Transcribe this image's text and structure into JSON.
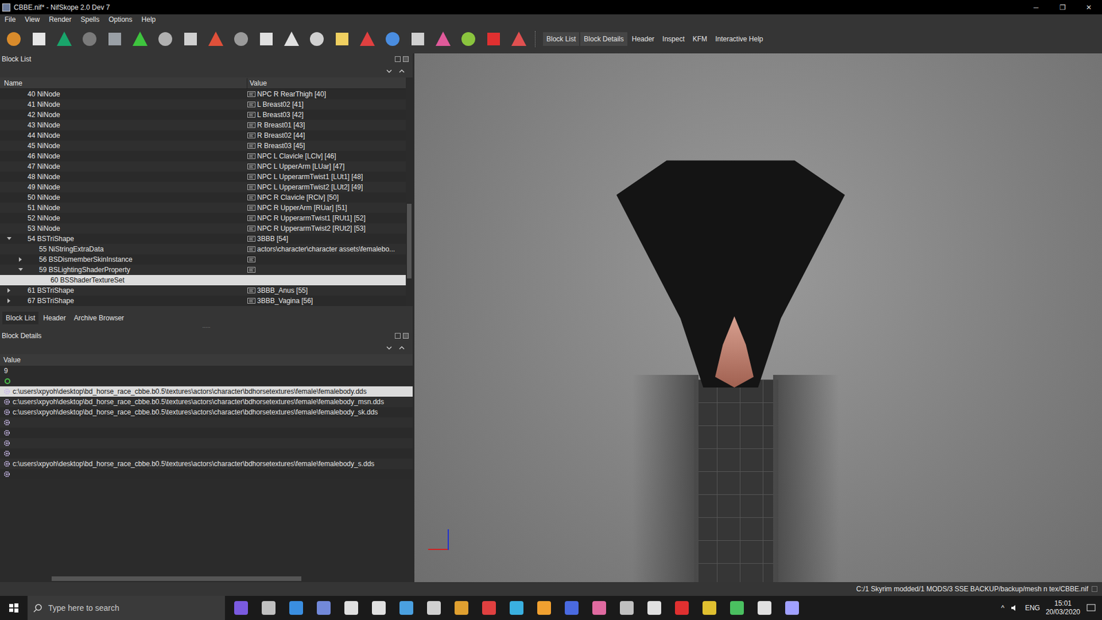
{
  "window": {
    "title": "CBBE.nif* - NifSkope 2.0 Dev 7",
    "controls": [
      "─",
      "❐",
      "✕"
    ]
  },
  "menu": [
    "File",
    "View",
    "Render",
    "Spells",
    "Options",
    "Help"
  ],
  "toolbar_toggles": [
    {
      "label": "Block List",
      "checked": true
    },
    {
      "label": "Block Details",
      "checked": true
    },
    {
      "label": "Header",
      "checked": false
    },
    {
      "label": "Inspect",
      "checked": false
    },
    {
      "label": "KFM",
      "checked": false
    },
    {
      "label": "Interactive Help",
      "checked": false
    }
  ],
  "block_list": {
    "title": "Block List",
    "columns": [
      "Name",
      "Value"
    ],
    "rows": [
      {
        "name": "40 NiNode",
        "value": "NPC R RearThigh [40]",
        "depth": 0,
        "expandable": false,
        "expanded": false,
        "selected": false
      },
      {
        "name": "41 NiNode",
        "value": "L Breast02 [41]",
        "depth": 0,
        "expandable": false,
        "expanded": false,
        "selected": false
      },
      {
        "name": "42 NiNode",
        "value": "L Breast03 [42]",
        "depth": 0,
        "expandable": false,
        "expanded": false,
        "selected": false
      },
      {
        "name": "43 NiNode",
        "value": "R Breast01 [43]",
        "depth": 0,
        "expandable": false,
        "expanded": false,
        "selected": false
      },
      {
        "name": "44 NiNode",
        "value": "R Breast02 [44]",
        "depth": 0,
        "expandable": false,
        "expanded": false,
        "selected": false
      },
      {
        "name": "45 NiNode",
        "value": "R Breast03 [45]",
        "depth": 0,
        "expandable": false,
        "expanded": false,
        "selected": false
      },
      {
        "name": "46 NiNode",
        "value": "NPC L Clavicle [LClv] [46]",
        "depth": 0,
        "expandable": false,
        "expanded": false,
        "selected": false
      },
      {
        "name": "47 NiNode",
        "value": "NPC L UpperArm [LUar] [47]",
        "depth": 0,
        "expandable": false,
        "expanded": false,
        "selected": false
      },
      {
        "name": "48 NiNode",
        "value": "NPC L UpperarmTwist1 [LUt1] [48]",
        "depth": 0,
        "expandable": false,
        "expanded": false,
        "selected": false
      },
      {
        "name": "49 NiNode",
        "value": "NPC L UpperarmTwist2 [LUt2] [49]",
        "depth": 0,
        "expandable": false,
        "expanded": false,
        "selected": false
      },
      {
        "name": "50 NiNode",
        "value": "NPC R Clavicle [RClv] [50]",
        "depth": 0,
        "expandable": false,
        "expanded": false,
        "selected": false
      },
      {
        "name": "51 NiNode",
        "value": "NPC R UpperArm [RUar] [51]",
        "depth": 0,
        "expandable": false,
        "expanded": false,
        "selected": false
      },
      {
        "name": "52 NiNode",
        "value": "NPC R UpperarmTwist1 [RUt1] [52]",
        "depth": 0,
        "expandable": false,
        "expanded": false,
        "selected": false
      },
      {
        "name": "53 NiNode",
        "value": "NPC R UpperarmTwist2 [RUt2] [53]",
        "depth": 0,
        "expandable": false,
        "expanded": false,
        "selected": false
      },
      {
        "name": "54 BSTriShape",
        "value": "3BBB [54]",
        "depth": 0,
        "expandable": true,
        "expanded": true,
        "selected": false
      },
      {
        "name": "55 NiStringExtraData",
        "value": "actors\\character\\character assets\\femalebo...",
        "depth": 1,
        "expandable": false,
        "expanded": false,
        "selected": false
      },
      {
        "name": "56 BSDismemberSkinInstance",
        "value": "",
        "depth": 1,
        "expandable": true,
        "expanded": false,
        "selected": false
      },
      {
        "name": "59 BSLightingShaderProperty",
        "value": "",
        "depth": 1,
        "expandable": true,
        "expanded": true,
        "selected": false
      },
      {
        "name": "60 BSShaderTextureSet",
        "value": "",
        "depth": 2,
        "expandable": false,
        "expanded": false,
        "selected": true
      },
      {
        "name": "61 BSTriShape",
        "value": "3BBB_Anus [55]",
        "depth": 0,
        "expandable": true,
        "expanded": false,
        "selected": false
      },
      {
        "name": "67 BSTriShape",
        "value": "3BBB_Vagina [56]",
        "depth": 0,
        "expandable": true,
        "expanded": false,
        "selected": false
      }
    ]
  },
  "dock_tabs": [
    {
      "label": "Block List",
      "selected": true
    },
    {
      "label": "Header",
      "selected": false
    },
    {
      "label": "Archive Browser",
      "selected": false
    }
  ],
  "block_details": {
    "title": "Block Details",
    "column": "Value",
    "count": "9",
    "rows": [
      {
        "value": "c:\\users\\xpyoh\\desktop\\bd_horse_race_cbbe.b0.5\\textures\\actors\\character\\bdhorsetextures\\female\\femalebody.dds",
        "selected": true
      },
      {
        "value": "c:\\users\\xpyoh\\desktop\\bd_horse_race_cbbe.b0.5\\textures\\actors\\character\\bdhorsetextures\\female\\femalebody_msn.dds",
        "selected": false
      },
      {
        "value": "c:\\users\\xpyoh\\desktop\\bd_horse_race_cbbe.b0.5\\textures\\actors\\character\\bdhorsetextures\\female\\femalebody_sk.dds",
        "selected": false
      },
      {
        "value": "",
        "selected": false
      },
      {
        "value": "",
        "selected": false
      },
      {
        "value": "",
        "selected": false
      },
      {
        "value": "",
        "selected": false
      },
      {
        "value": "c:\\users\\xpyoh\\desktop\\bd_horse_race_cbbe.b0.5\\textures\\actors\\character\\bdhorsetextures\\female\\femalebody_s.dds",
        "selected": false
      },
      {
        "value": "",
        "selected": false
      }
    ]
  },
  "status_bar": {
    "path": "C:/1 Skyrim modded/1 MODS/3 SSE BACKUP/backup/mesh n tex/CBBE.nif"
  },
  "taskbar": {
    "search_placeholder": "Type here to search",
    "language": "ENG",
    "time": "15:01",
    "date": "20/03/2020",
    "tray_arrow": "^"
  }
}
